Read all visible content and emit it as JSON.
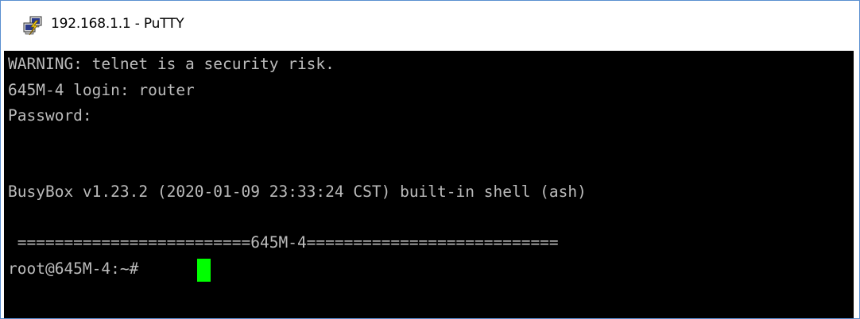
{
  "window": {
    "title": "192.168.1.1 - PuTTY",
    "icon": "putty-icon"
  },
  "terminal": {
    "lines": [
      "WARNING: telnet is a security risk.",
      "645M-4 login: router",
      "Password:",
      "",
      "",
      "BusyBox v1.23.2 (2020-01-09 23:33:24 CST) built-in shell (ash)",
      "",
      " =========================645M-4===========================",
      "root@645M-4:~# "
    ],
    "colors": {
      "background": "#000000",
      "foreground": "#bbbbbb",
      "cursor": "#00ff00"
    }
  }
}
